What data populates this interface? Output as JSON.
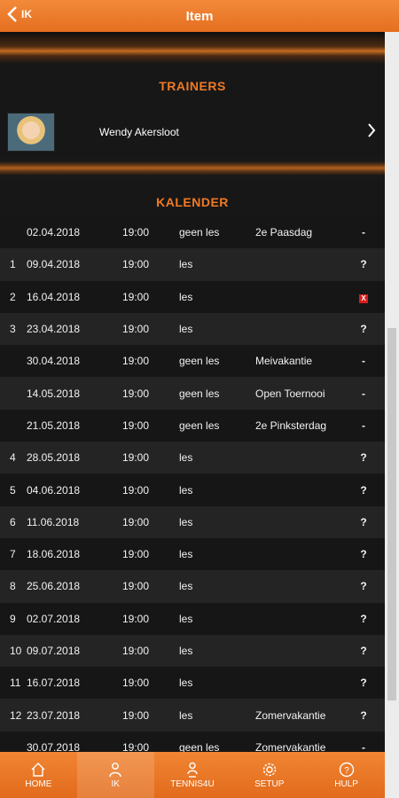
{
  "header": {
    "back_label": "IK",
    "title": "Item"
  },
  "trainers": {
    "title": "TRAINERS",
    "items": [
      {
        "name": "Wendy Akersloot"
      }
    ]
  },
  "kalender": {
    "title": "KALENDER",
    "rows": [
      {
        "no": "",
        "date": "02.04.2018",
        "time": "19:00",
        "status": "geen les",
        "note": "2e Paasdag",
        "end": "-"
      },
      {
        "no": "1",
        "date": "09.04.2018",
        "time": "19:00",
        "status": "les",
        "note": "",
        "end": "?"
      },
      {
        "no": "2",
        "date": "16.04.2018",
        "time": "19:00",
        "status": "les",
        "note": "",
        "end": "X"
      },
      {
        "no": "3",
        "date": "23.04.2018",
        "time": "19:00",
        "status": "les",
        "note": "",
        "end": "?"
      },
      {
        "no": "",
        "date": "30.04.2018",
        "time": "19:00",
        "status": "geen les",
        "note": "Meivakantie",
        "end": "-"
      },
      {
        "no": "",
        "date": "14.05.2018",
        "time": "19:00",
        "status": "geen les",
        "note": "Open Toernooi",
        "end": "-"
      },
      {
        "no": "",
        "date": "21.05.2018",
        "time": "19:00",
        "status": "geen les",
        "note": "2e Pinksterdag",
        "end": "-"
      },
      {
        "no": "4",
        "date": "28.05.2018",
        "time": "19:00",
        "status": "les",
        "note": "",
        "end": "?"
      },
      {
        "no": "5",
        "date": "04.06.2018",
        "time": "19:00",
        "status": "les",
        "note": "",
        "end": "?"
      },
      {
        "no": "6",
        "date": "11.06.2018",
        "time": "19:00",
        "status": "les",
        "note": "",
        "end": "?"
      },
      {
        "no": "7",
        "date": "18.06.2018",
        "time": "19:00",
        "status": "les",
        "note": "",
        "end": "?"
      },
      {
        "no": "8",
        "date": "25.06.2018",
        "time": "19:00",
        "status": "les",
        "note": "",
        "end": "?"
      },
      {
        "no": "9",
        "date": "02.07.2018",
        "time": "19:00",
        "status": "les",
        "note": "",
        "end": "?"
      },
      {
        "no": "10",
        "date": "09.07.2018",
        "time": "19:00",
        "status": "les",
        "note": "",
        "end": "?"
      },
      {
        "no": "11",
        "date": "16.07.2018",
        "time": "19:00",
        "status": "les",
        "note": "",
        "end": "?"
      },
      {
        "no": "12",
        "date": "23.07.2018",
        "time": "19:00",
        "status": "les",
        "note": "Zomervakantie",
        "end": "?"
      },
      {
        "no": "",
        "date": "30.07.2018",
        "time": "19:00",
        "status": "geen les",
        "note": "Zomervakantie",
        "end": "-"
      }
    ]
  },
  "footer": {
    "tabs": [
      {
        "label": "HOME",
        "icon": "home-icon",
        "active": false
      },
      {
        "label": "IK",
        "icon": "person-icon",
        "active": true
      },
      {
        "label": "TENNIS4U",
        "icon": "group-icon",
        "active": false
      },
      {
        "label": "SETUP",
        "icon": "gear-icon",
        "active": false
      },
      {
        "label": "HULP",
        "icon": "help-icon",
        "active": false
      }
    ]
  },
  "colors": {
    "accent": "#e8731f",
    "section_title": "#f07a24",
    "cancel": "#d91c1c"
  }
}
